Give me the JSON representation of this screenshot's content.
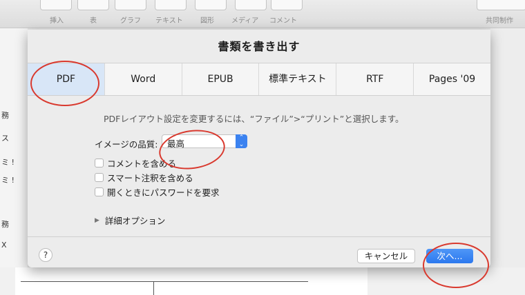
{
  "toolbar": {
    "items": [
      "挿入",
      "表",
      "グラフ",
      "テキスト",
      "図形",
      "メディア",
      "コメント"
    ],
    "right_item": "共同制作"
  },
  "background": {
    "side_chars": [
      "務",
      "ス",
      "ミ !",
      "ミ !",
      "務",
      "X"
    ]
  },
  "dialog": {
    "title": "書類を書き出す",
    "tabs": [
      "PDF",
      "Word",
      "EPUB",
      "標準テキスト",
      "RTF",
      "Pages '09"
    ],
    "selected_tab": "PDF",
    "hint": "PDFレイアウト設定を変更するには、“ファイル”>“プリント”と選択します。",
    "image_quality": {
      "label": "イメージの品質:",
      "value": "最高"
    },
    "checkboxes": [
      {
        "label": "コメントを含める",
        "checked": false
      },
      {
        "label": "スマート注釈を含める",
        "checked": false
      },
      {
        "label": "開くときにパスワードを要求",
        "checked": false
      }
    ],
    "details_label": "詳細オプション",
    "help_label": "?",
    "cancel_label": "キャンセル",
    "next_label": "次へ..."
  },
  "colors": {
    "accent": "#3b82f0",
    "selected_tab": "#d8e6f7",
    "annotation": "#d9392e"
  }
}
